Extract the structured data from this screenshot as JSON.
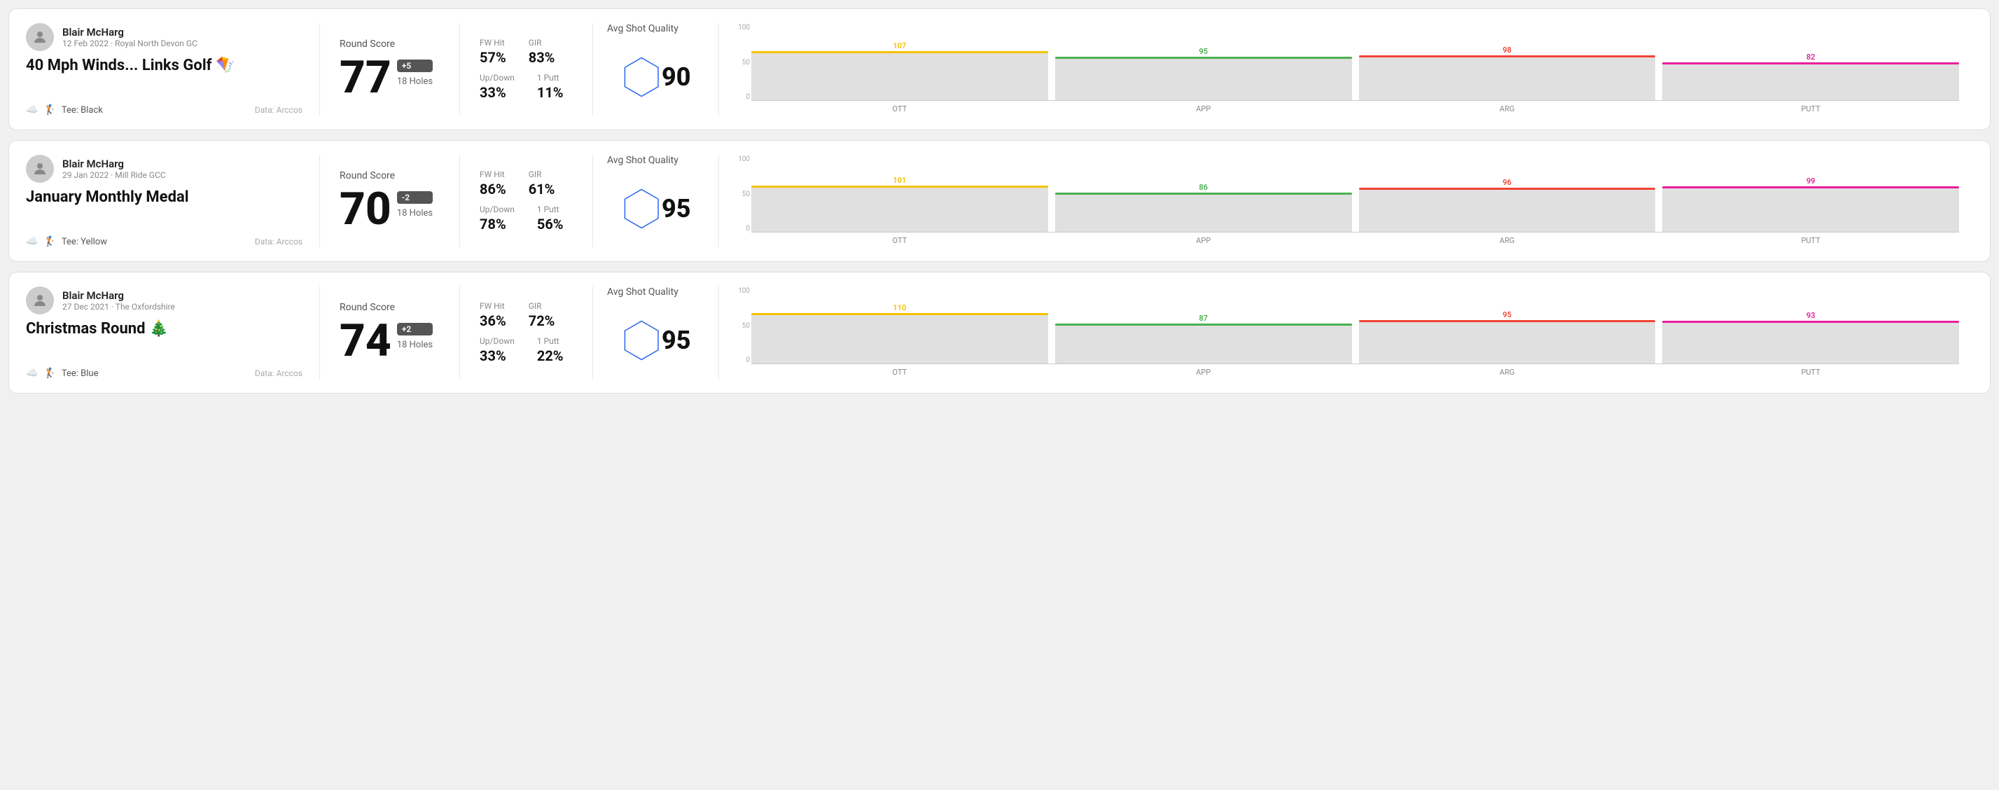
{
  "rounds": [
    {
      "id": "round1",
      "user": {
        "name": "Blair McHarg",
        "meta": "12 Feb 2022 · Royal North Devon GC"
      },
      "title": "40 Mph Winds... Links Golf 🪁",
      "tee": "Black",
      "data_source": "Data: Arccos",
      "score": {
        "label": "Round Score",
        "number": "77",
        "modifier": "+5",
        "holes": "18 Holes"
      },
      "stats": {
        "fw_hit_label": "FW Hit",
        "fw_hit_value": "57%",
        "gir_label": "GIR",
        "gir_value": "83%",
        "updown_label": "Up/Down",
        "updown_value": "33%",
        "oneputt_label": "1 Putt",
        "oneputt_value": "11%"
      },
      "quality": {
        "label": "Avg Shot Quality",
        "score": "90"
      },
      "chart": {
        "bars": [
          {
            "label": "OTT",
            "value": 107,
            "color": "#f5c200",
            "max": 120
          },
          {
            "label": "APP",
            "value": 95,
            "color": "#4caf50",
            "max": 120
          },
          {
            "label": "ARG",
            "value": 98,
            "color": "#f44336",
            "max": 120
          },
          {
            "label": "PUTT",
            "value": 82,
            "color": "#e91e9c",
            "max": 120
          }
        ]
      }
    },
    {
      "id": "round2",
      "user": {
        "name": "Blair McHarg",
        "meta": "29 Jan 2022 · Mill Ride GCC"
      },
      "title": "January Monthly Medal",
      "tee": "Yellow",
      "data_source": "Data: Arccos",
      "score": {
        "label": "Round Score",
        "number": "70",
        "modifier": "-2",
        "holes": "18 Holes"
      },
      "stats": {
        "fw_hit_label": "FW Hit",
        "fw_hit_value": "86%",
        "gir_label": "GIR",
        "gir_value": "61%",
        "updown_label": "Up/Down",
        "updown_value": "78%",
        "oneputt_label": "1 Putt",
        "oneputt_value": "56%"
      },
      "quality": {
        "label": "Avg Shot Quality",
        "score": "95"
      },
      "chart": {
        "bars": [
          {
            "label": "OTT",
            "value": 101,
            "color": "#f5c200",
            "max": 120
          },
          {
            "label": "APP",
            "value": 86,
            "color": "#4caf50",
            "max": 120
          },
          {
            "label": "ARG",
            "value": 96,
            "color": "#f44336",
            "max": 120
          },
          {
            "label": "PUTT",
            "value": 99,
            "color": "#e91e9c",
            "max": 120
          }
        ]
      }
    },
    {
      "id": "round3",
      "user": {
        "name": "Blair McHarg",
        "meta": "27 Dec 2021 · The Oxfordshire"
      },
      "title": "Christmas Round 🎄",
      "tee": "Blue",
      "data_source": "Data: Arccos",
      "score": {
        "label": "Round Score",
        "number": "74",
        "modifier": "+2",
        "holes": "18 Holes"
      },
      "stats": {
        "fw_hit_label": "FW Hit",
        "fw_hit_value": "36%",
        "gir_label": "GIR",
        "gir_value": "72%",
        "updown_label": "Up/Down",
        "updown_value": "33%",
        "oneputt_label": "1 Putt",
        "oneputt_value": "22%"
      },
      "quality": {
        "label": "Avg Shot Quality",
        "score": "95"
      },
      "chart": {
        "bars": [
          {
            "label": "OTT",
            "value": 110,
            "color": "#f5c200",
            "max": 120
          },
          {
            "label": "APP",
            "value": 87,
            "color": "#4caf50",
            "max": 120
          },
          {
            "label": "ARG",
            "value": 95,
            "color": "#f44336",
            "max": 120
          },
          {
            "label": "PUTT",
            "value": 93,
            "color": "#e91e9c",
            "max": 120
          }
        ]
      }
    }
  ],
  "y_axis_labels": [
    "100",
    "50",
    "0"
  ]
}
